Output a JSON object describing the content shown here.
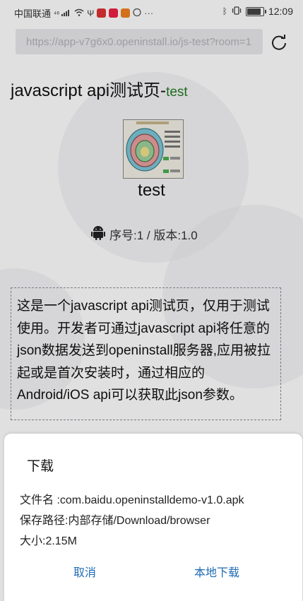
{
  "statusbar": {
    "carrier": "中国联通",
    "signal_text": "⁴⁶",
    "time": "12:09",
    "battery_level": 0.8
  },
  "browser": {
    "url": "https://app-v7g6x0.openinstall.io/js-test?room=1"
  },
  "page": {
    "title": "javascript api测试页-",
    "title_tag": "test",
    "app_name": "test",
    "version_line": "序号:1 / 版本:1.0",
    "description": "这是一个javascript api测试页，仅用于测试使用。开发者可通过javascript api将任意的json数据发送到openinstall服务器,应用被拉起或是首次安装时，通过相应的Android/iOS api可以获取此json参数。"
  },
  "download_dialog": {
    "title": "下载",
    "filename": "文件名 :com.baidu.openinstalldemo-v1.0.apk",
    "save_path": "保存路径:内部存储/Download/browser",
    "size": "大小:2.15M",
    "cancel_label": "取消",
    "confirm_label": "本地下载"
  },
  "colors": {
    "link_blue": "#1f6bb5",
    "tag_green": "#1f7a1f"
  }
}
